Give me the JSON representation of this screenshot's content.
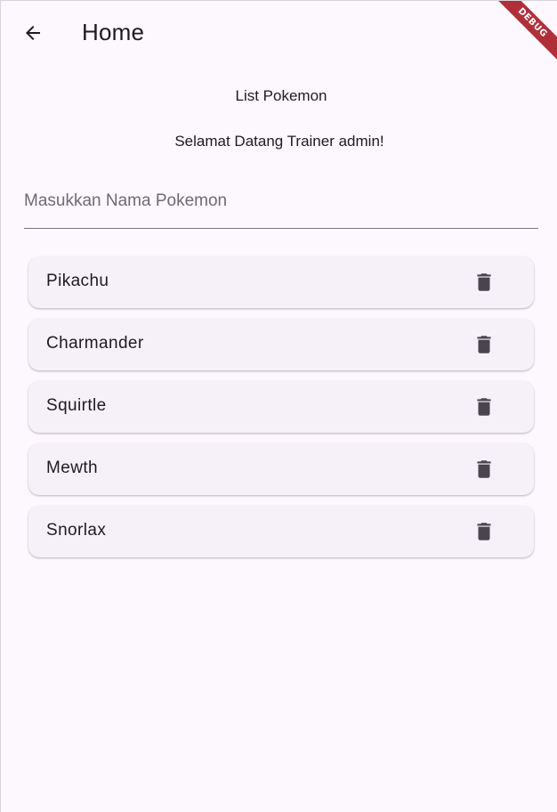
{
  "appbar": {
    "title": "Home",
    "back_icon": "arrow-back-icon",
    "debug_label": "DEBUG"
  },
  "main": {
    "list_heading": "List Pokemon",
    "welcome_text": "Selamat Datang Trainer admin!",
    "name_input": {
      "value": "",
      "placeholder": "Masukkan Nama Pokemon"
    },
    "pokemon": [
      {
        "name": "Pikachu",
        "action_icon": "trash-icon"
      },
      {
        "name": "Charmander",
        "action_icon": "trash-icon"
      },
      {
        "name": "Squirtle",
        "action_icon": "trash-icon"
      },
      {
        "name": "Mewth",
        "action_icon": "trash-icon"
      },
      {
        "name": "Snorlax",
        "action_icon": "trash-icon"
      }
    ]
  },
  "colors": {
    "background": "#fdf7fe",
    "card": "#f6f1f8",
    "text": "#1d1b20",
    "icon": "#49454f",
    "debug_ribbon": "#b0303a"
  }
}
